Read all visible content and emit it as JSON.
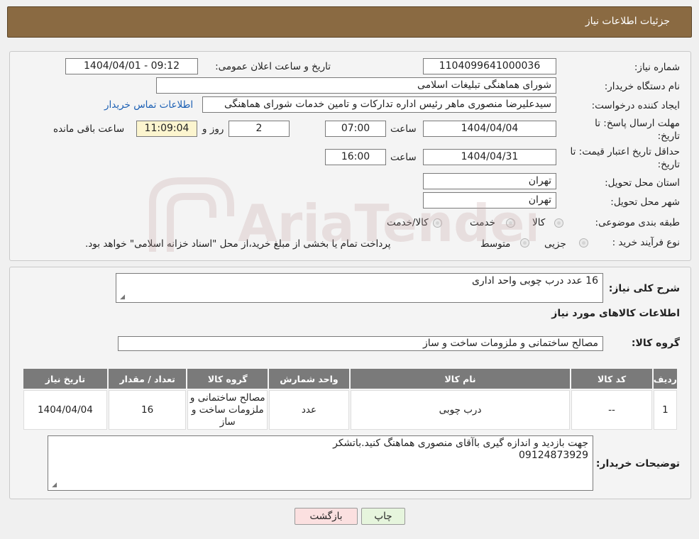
{
  "header": {
    "title": "جزئیات اطلاعات نیاز"
  },
  "form": {
    "need_number_label": "شماره نیاز:",
    "need_number": "1104099641000036",
    "announce_label": "تاریخ و ساعت اعلان عمومی:",
    "announce_value": "1404/04/01 - 09:12",
    "buyer_org_label": "نام دستگاه خریدار:",
    "buyer_org": "شورای هماهنگی تبلیغات اسلامی",
    "creator_label": "ایجاد کننده درخواست:",
    "creator": "سیدعلیرضا منصوری ماهر رئیس اداره تدارکات و تامین خدمات  شورای هماهنگی",
    "contact_link": "اطلاعات تماس خریدار",
    "deadline_label": "مهلت ارسال پاسخ: تا تاریخ:",
    "deadline_date": "1404/04/04",
    "time_label": "ساعت",
    "deadline_time": "07:00",
    "days_value": "2",
    "days_label": "روز و",
    "remaining_time": "11:09:04",
    "remaining_label": "ساعت باقی مانده",
    "validity_label": "حداقل تاریخ اعتبار قیمت: تا تاریخ:",
    "validity_date": "1404/04/31",
    "validity_time": "16:00",
    "province_label": "استان محل تحویل:",
    "province": "تهران",
    "city_label": "شهر محل تحویل:",
    "city": "تهران",
    "category_label": "طبقه بندی موضوعی:",
    "category_options": [
      "کالا",
      "خدمت",
      "کالا/خدمت"
    ],
    "purchase_type_label": "نوع فرآیند خرید :",
    "purchase_options": [
      "جزیی",
      "متوسط"
    ],
    "purchase_note": "پرداخت تمام یا بخشی از مبلغ خرید،از محل \"اسناد خزانه اسلامی\" خواهد بود."
  },
  "summary": {
    "overall_label": "شرح کلی نیاز:",
    "overall_value": "16 عدد درب چوبی واحد اداری",
    "goods_info_title": "اطلاعات کالاهای مورد نیاز",
    "goods_group_label": "گروه کالا:",
    "goods_group_value": "مصالح ساختمانی و ملزومات ساخت و ساز"
  },
  "table": {
    "headers": [
      "ردیف",
      "کد کالا",
      "نام کالا",
      "واحد شمارش",
      "گروه کالا",
      "تعداد / مقدار",
      "تاریخ نیاز"
    ],
    "rows": [
      {
        "row": "1",
        "code": "--",
        "name": "درب چوبی",
        "unit": "عدد",
        "group": "مصالح ساختمانی و ملزومات ساخت و ساز",
        "qty": "16",
        "date": "1404/04/04"
      }
    ]
  },
  "buyer_notes": {
    "label": "توضیحات خریدار:",
    "line1": "جهت بازدید و اندازه گیری باآقای منصوری هماهنگ کنید.باتشکر",
    "line2": "09124873929"
  },
  "buttons": {
    "print": "چاپ",
    "back": "بازگشت"
  },
  "watermark": {
    "text": "AriaTender.neT"
  },
  "colors": {
    "header_bg": "#8a6a42",
    "table_header_bg": "#7a7a7a",
    "link": "#1a5fb4",
    "remaining_bg": "#fcf5cf"
  }
}
